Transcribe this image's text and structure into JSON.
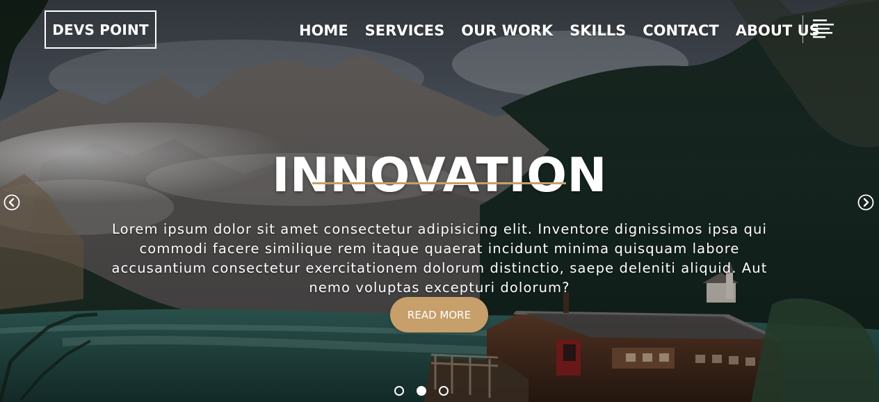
{
  "brand": {
    "logo_text": "DEVS POINT"
  },
  "nav": {
    "items": [
      "HOME",
      "SERVICES",
      "OUR WORK",
      "SKILLS",
      "CONTACT",
      "ABOUT US"
    ],
    "menu_icon": "hamburger-menu-icon"
  },
  "hero": {
    "title": "INNOVATION",
    "description": "Lorem ipsum dolor sit amet consectetur adipisicing elit. Inventore dignissimos ipsa qui commodi facere similique rem itaque quaerat incidunt minima quisquam labore accusantium consectetur exercitationem dolorum distinctio, saepe deleniti aliquid. Aut nemo voluptas excepturi dolorum?",
    "button_label": "READ MORE",
    "prev_icon": "chevron-left-icon",
    "next_icon": "chevron-right-icon"
  },
  "carousel": {
    "dot_count": 3,
    "active_index": 1
  },
  "colors": {
    "accent": "#c79f6b",
    "text": "#ffffff"
  }
}
